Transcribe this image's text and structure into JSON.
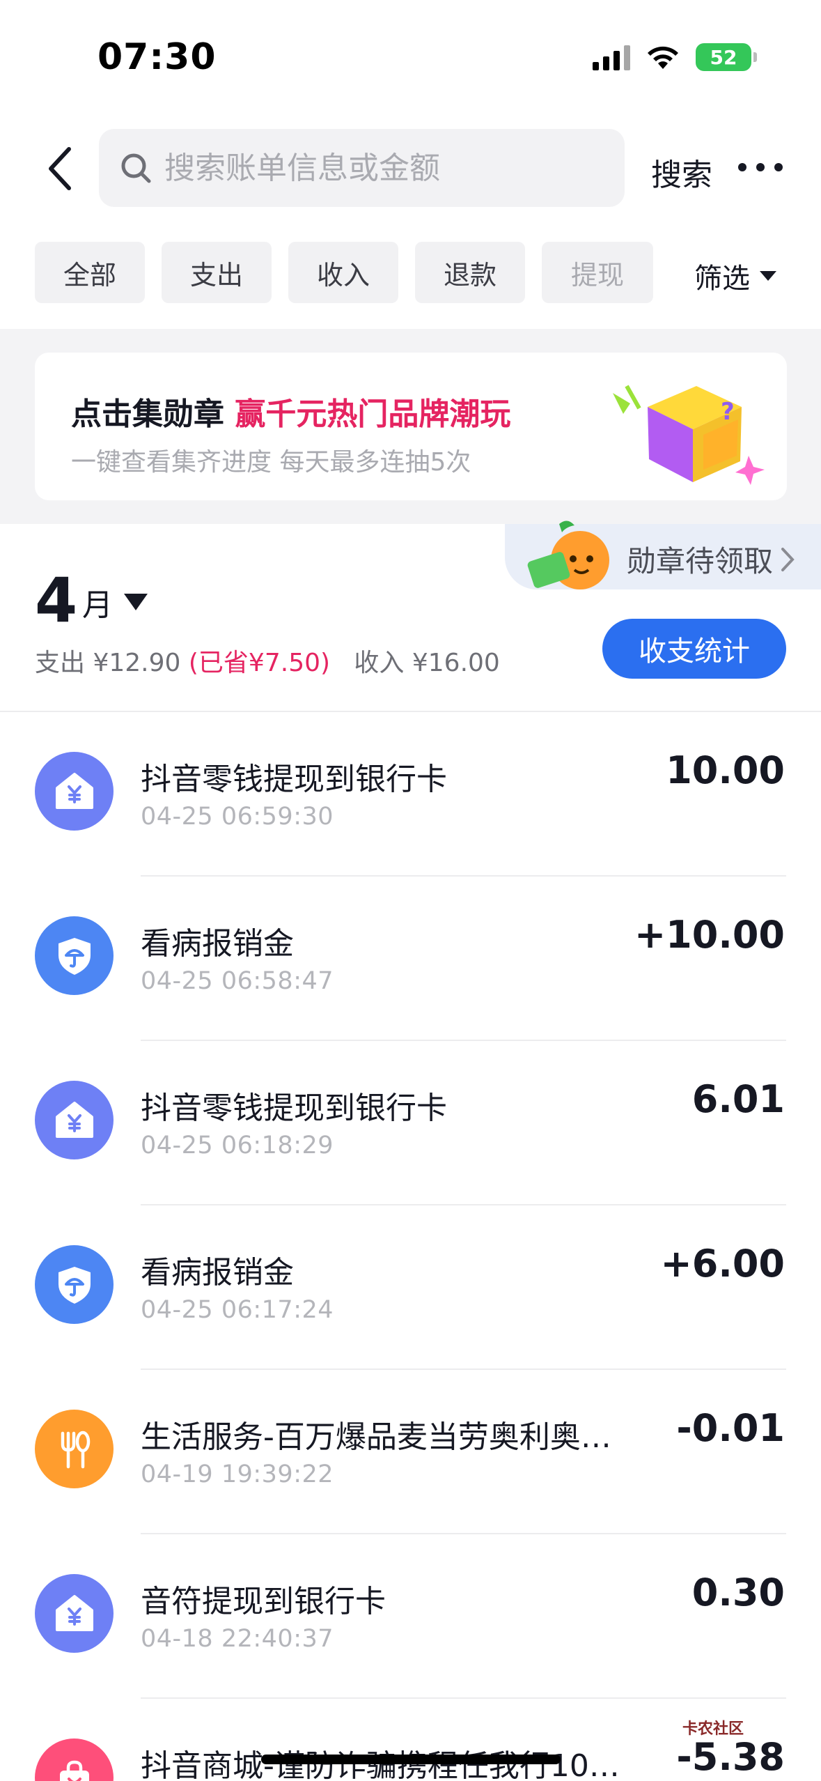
{
  "status_bar": {
    "time": "07:30",
    "battery": "52"
  },
  "search": {
    "placeholder": "搜索账单信息或金额",
    "button_label": "搜索"
  },
  "filters": {
    "chips": [
      "全部",
      "支出",
      "收入",
      "退款",
      "提现"
    ],
    "dropdown_label": "筛选"
  },
  "promo": {
    "title": "点击集勋章",
    "highlight": "赢千元热门品牌潮玩",
    "subtitle": "一键查看集齐进度 每天最多连抽5次"
  },
  "badge": {
    "label": "勋章待领取"
  },
  "month": {
    "number": "4",
    "unit": "月",
    "expense_label": "支出",
    "expense_value": "¥12.90",
    "saved": "(已省¥7.50)",
    "income_label": "收入",
    "income_value": "¥16.00",
    "stats_button": "收支统计"
  },
  "transactions": [
    {
      "title": "抖音零钱提现到银行卡",
      "time": "04-25 06:59:30",
      "amount": "10.00",
      "icon": "yuan-house-icon",
      "color": "#6e80f5"
    },
    {
      "title": "看病报销金",
      "time": "04-25 06:58:47",
      "amount": "+10.00",
      "icon": "shield-umbrella-icon",
      "color": "#4d86f3"
    },
    {
      "title": "抖音零钱提现到银行卡",
      "time": "04-25 06:18:29",
      "amount": "6.01",
      "icon": "yuan-house-icon",
      "color": "#6e80f5"
    },
    {
      "title": "看病报销金",
      "time": "04-25 06:17:24",
      "amount": "+6.00",
      "icon": "shield-umbrella-icon",
      "color": "#4d86f3"
    },
    {
      "title": "生活服务-百万爆品麦当劳奥利奥…",
      "time": "04-19 19:39:22",
      "amount": "-0.01",
      "icon": "fork-knife-icon",
      "color": "#ff9d2e"
    },
    {
      "title": "音符提现到银行卡",
      "time": "04-18 22:40:37",
      "amount": "0.30",
      "icon": "yuan-house-icon",
      "color": "#6e80f5"
    },
    {
      "title": "抖音商城-谨防诈骗携程任我行10…",
      "time": "",
      "amount": "-5.38",
      "icon": "shopping-bag-icon",
      "color": "#fe4f7a"
    }
  ],
  "watermark": "卡农社区"
}
